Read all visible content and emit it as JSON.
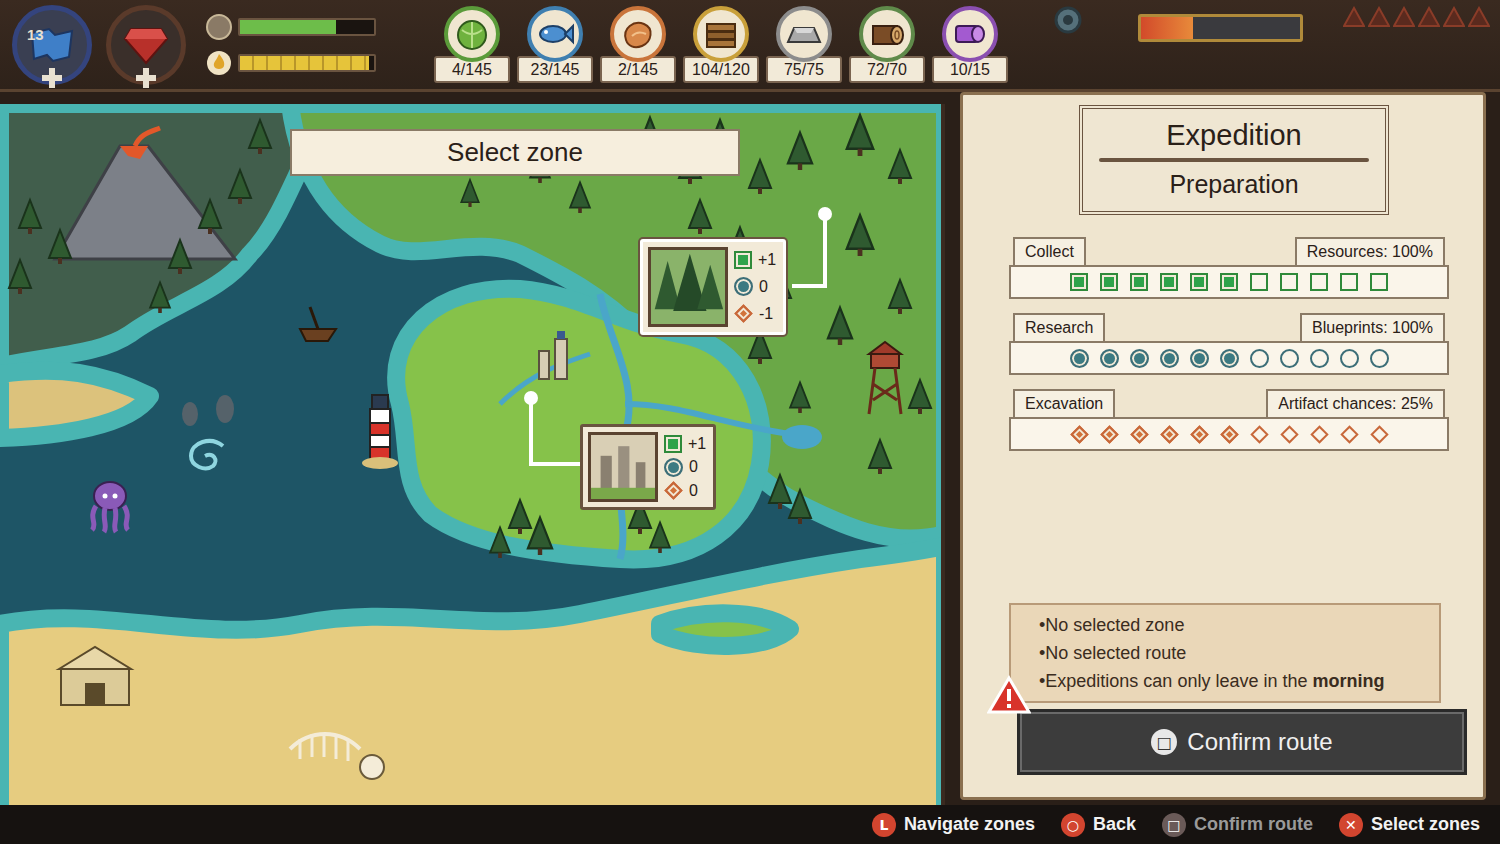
{
  "hud": {
    "day": "13",
    "health_level": 0.72,
    "energy_level": 0.96,
    "temperature_level": 0.33,
    "threat_marks": [
      {
        "lit": false
      },
      {
        "lit": false
      },
      {
        "lit": false
      },
      {
        "lit": false
      },
      {
        "lit": false
      },
      {
        "lit": false
      }
    ]
  },
  "resources": [
    {
      "kind": "cabbage",
      "count": "4/145",
      "color": "#5b9b3a"
    },
    {
      "kind": "fish",
      "count": "23/145",
      "color": "#3f7fb0"
    },
    {
      "kind": "meat",
      "count": "2/145",
      "color": "#c9743a"
    },
    {
      "kind": "planks",
      "count": "104/120",
      "color": "#c9a03a"
    },
    {
      "kind": "ingot",
      "count": "75/75",
      "color": "#8c8c8c"
    },
    {
      "kind": "log",
      "count": "72/70",
      "color": "#5f8a4a"
    },
    {
      "kind": "cloth",
      "count": "10/15",
      "color": "#8a4fb0"
    }
  ],
  "map": {
    "banner": "Select zone",
    "zones": [
      {
        "kind": "forest",
        "selected": true,
        "collect": "+1",
        "research": "0",
        "excavation": "-1"
      },
      {
        "kind": "ruins",
        "selected": false,
        "collect": "+1",
        "research": "0",
        "excavation": "0"
      }
    ]
  },
  "panel": {
    "title": "Expedition",
    "subtitle": "Preparation",
    "meters": [
      {
        "kind": "square",
        "label": "Collect",
        "reading": "Resources: 100%",
        "filled": 6,
        "slots": 11
      },
      {
        "kind": "circle",
        "label": "Research",
        "reading": "Blueprints: 100%",
        "filled": 6,
        "slots": 11
      },
      {
        "kind": "diamond",
        "label": "Excavation",
        "reading": "Artifact chances: 25%",
        "filled": 6,
        "slots": 11
      }
    ],
    "warnings": [
      {
        "parts": [
          {
            "text": "•No selected zone",
            "bold": false
          }
        ]
      },
      {
        "parts": [
          {
            "text": "•No selected route",
            "bold": false
          }
        ]
      },
      {
        "parts": [
          {
            "text": "•Expeditions can only leave in the",
            "bold": false
          },
          {
            "text": "morning",
            "bold": true
          }
        ]
      }
    ],
    "confirm": {
      "glyph": "□",
      "label": "Confirm route",
      "disabled": true
    }
  },
  "hints": [
    {
      "glyph": "L",
      "label": "Navigate zones",
      "disabled": false
    },
    {
      "glyph": "○",
      "label": "Back",
      "disabled": false
    },
    {
      "glyph": "□",
      "label": "Confirm route",
      "disabled": true
    },
    {
      "glyph": "✕",
      "label": "Select zones",
      "disabled": false
    }
  ]
}
